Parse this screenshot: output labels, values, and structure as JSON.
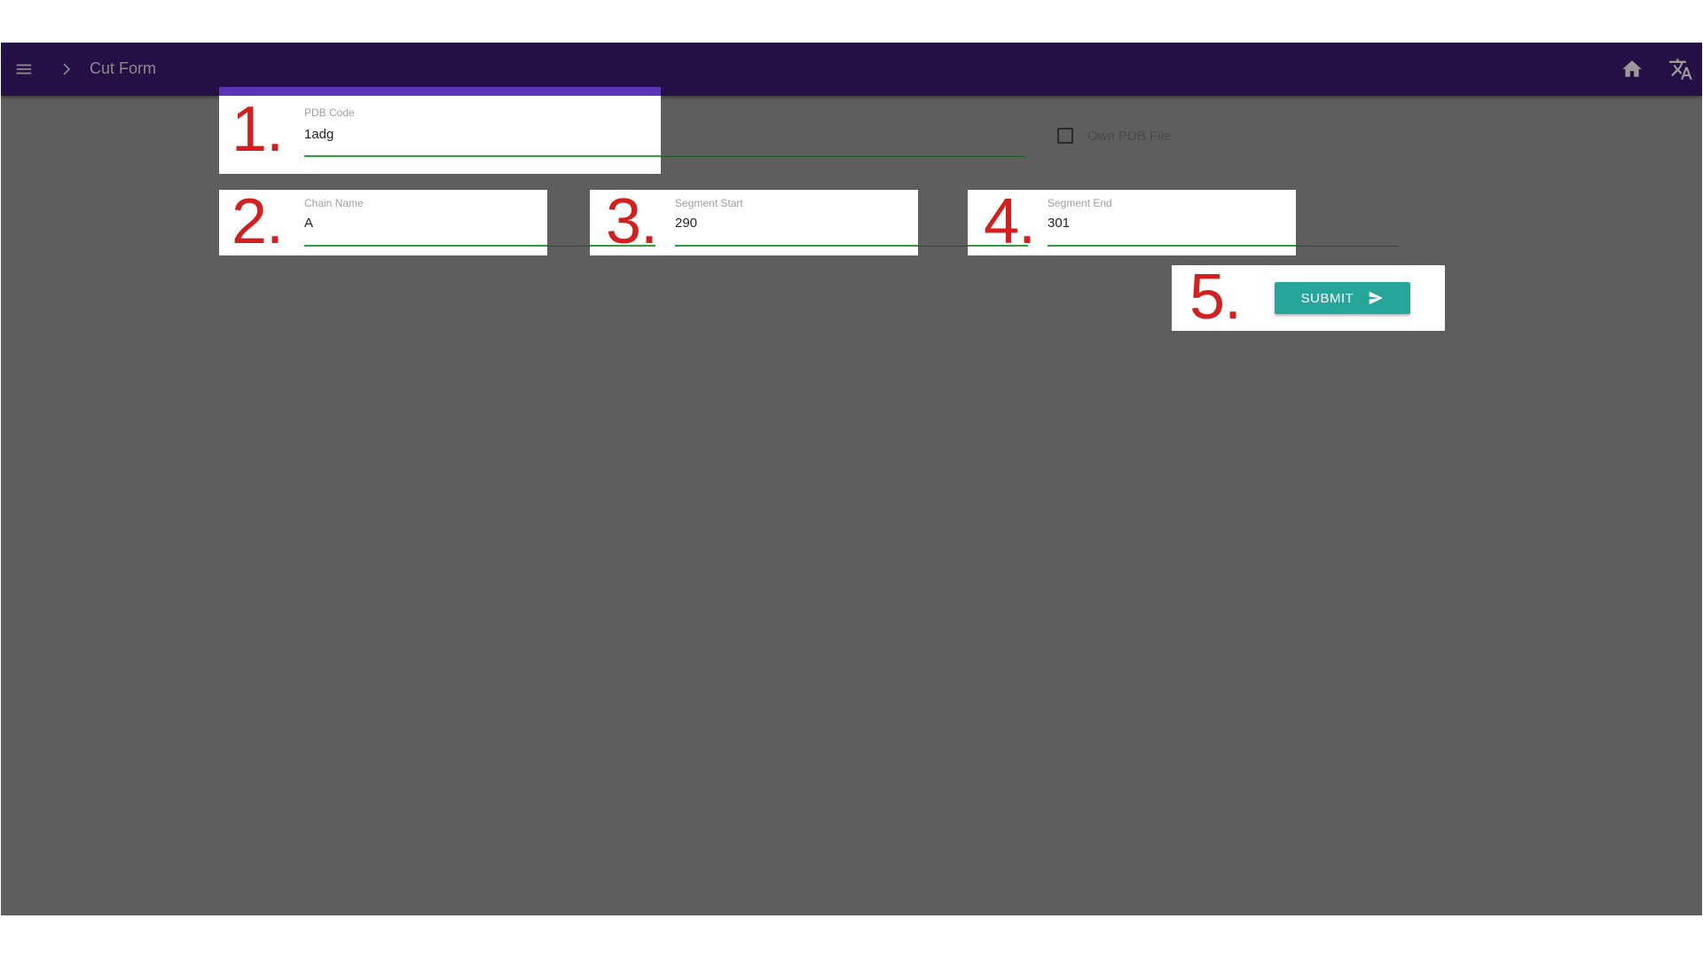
{
  "toolbar": {
    "title": "Cut Form",
    "icons": {
      "menu": "menu-icon",
      "breadcrumb_separator": "chevron-right-icon",
      "home": "home-icon",
      "translate": "translate-icon"
    },
    "background_color": "#241044"
  },
  "annotations": [
    "1.",
    "2.",
    "3.",
    "4.",
    "5."
  ],
  "form": {
    "pdb_code": {
      "label": "PDB Code",
      "value": "1adg"
    },
    "own_pdb_file": {
      "label": "Own PDB File",
      "checked": false
    },
    "chain_name": {
      "label": "Chain Name",
      "value": "A"
    },
    "segment_start": {
      "label": "Segment Start",
      "value": "290"
    },
    "segment_end": {
      "label": "Segment End",
      "value": "301"
    },
    "submit": {
      "label": "SUBMIT",
      "icon": "send-icon",
      "color": "#26a69a"
    }
  },
  "colors": {
    "annotation_number": "#d51f1f",
    "active_field_underline": "#2e9e3a",
    "active_tab_accent": "#5a34b8",
    "page_background": "#5e5e5e"
  }
}
